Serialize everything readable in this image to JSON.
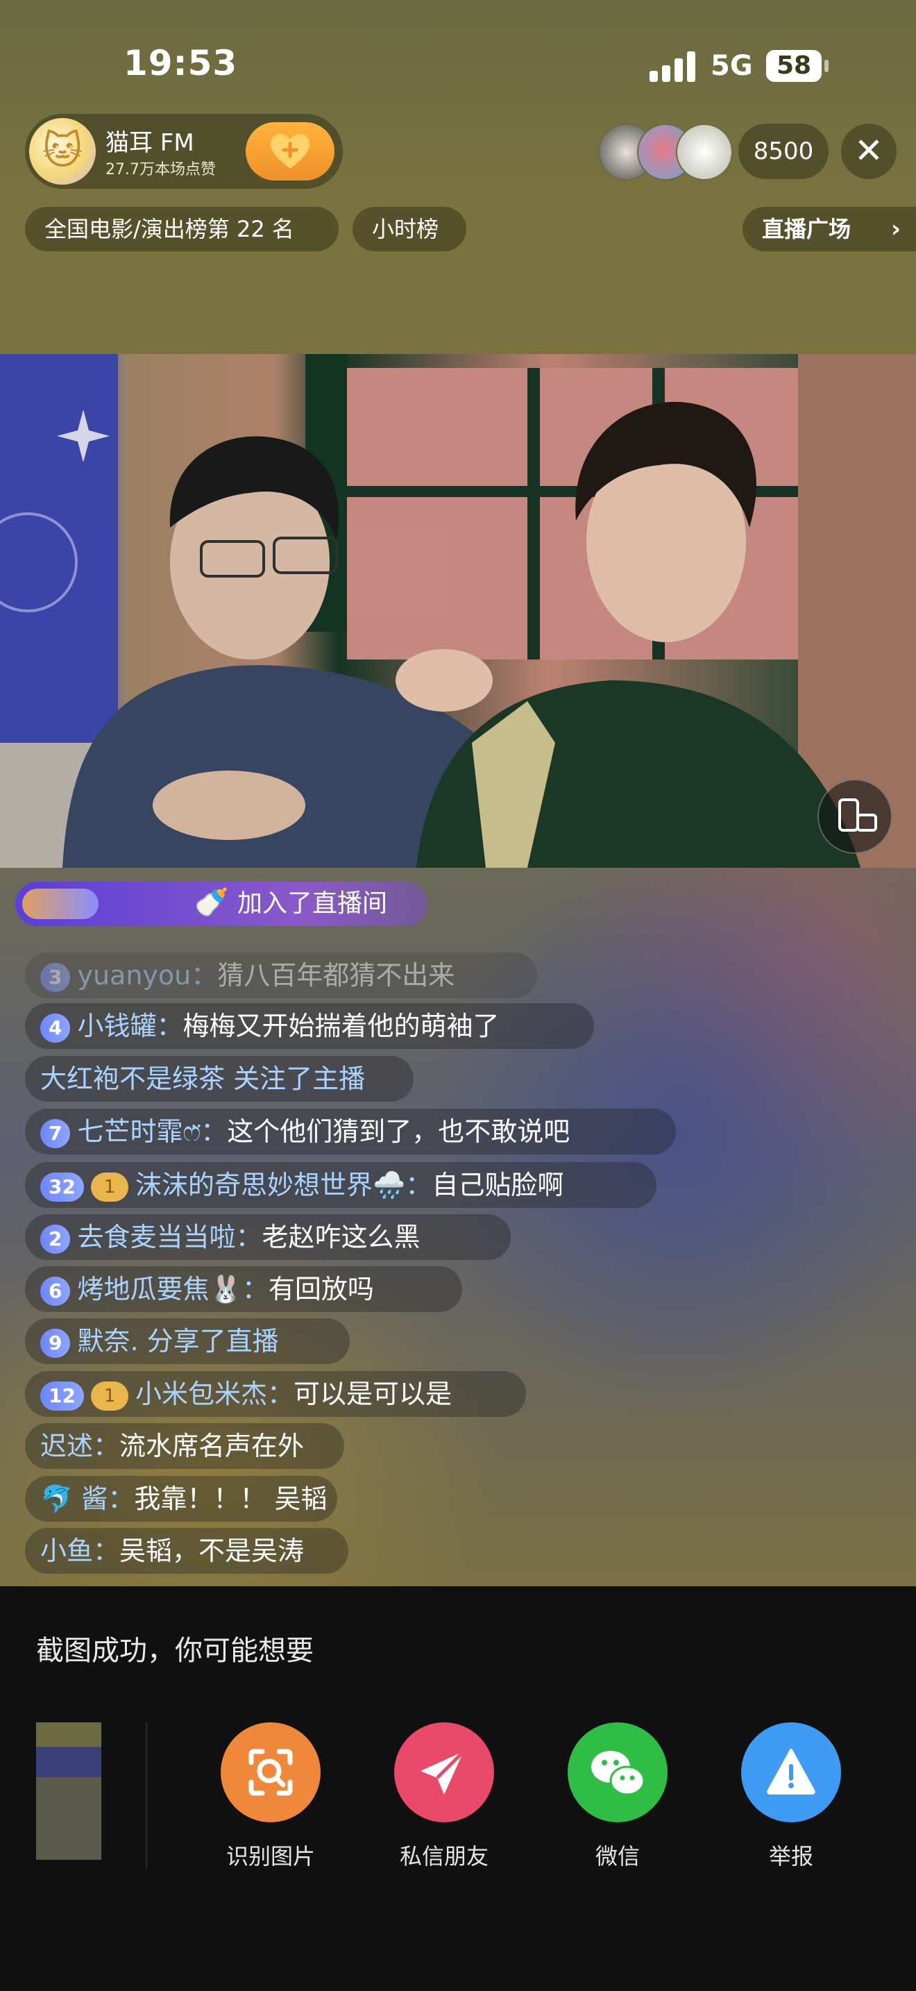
{
  "status_bar": {
    "time": "19:53",
    "network": "5G",
    "battery": "58"
  },
  "host": {
    "name": "猫耳 FM",
    "likes": "27.7万本场点赞",
    "avatar_icon": "cat-ear-icon"
  },
  "viewer_count": "8500",
  "rank_pill": "全国电影/演出榜第 22 名",
  "hour_pill": "小时榜",
  "plaza_label": "直播广场",
  "join_banner": {
    "text": "加入了直播间"
  },
  "chat": [
    {
      "level": "3",
      "badge": "",
      "name": "yuanyou",
      "sep": "：",
      "message": "猜八百年都猜不出来",
      "faded": true
    },
    {
      "level": "4",
      "badge": "",
      "name": "小钱罐",
      "sep": "：",
      "message": "梅梅又开始揣着他的萌袖了",
      "faded": false
    },
    {
      "level": "",
      "badge": "",
      "name": "大红袍不是绿茶 关注了主播",
      "sep": "",
      "message": "",
      "faded": false,
      "plain": true
    },
    {
      "level": "7",
      "badge": "",
      "name": "七芒时霏ෆ̈",
      "sep": "：",
      "message": "这个他们猜到了，也不敢说吧",
      "faded": false
    },
    {
      "level": "32",
      "badge": "1",
      "name": "沫沫的奇思妙想世界🌧️",
      "sep": "：",
      "message": "自己贴脸啊",
      "faded": false
    },
    {
      "level": "2",
      "badge": "",
      "name": "去食麦当当啦",
      "sep": "：",
      "message": "老赵咋这么黑",
      "faded": false
    },
    {
      "level": "6",
      "badge": "",
      "name": "烤地瓜要焦🐰",
      "sep": "：",
      "message": "有回放吗",
      "faded": false
    },
    {
      "level": "9",
      "badge": "",
      "name": "默奈. 分享了直播",
      "sep": "",
      "message": "",
      "faded": false,
      "plain": false
    },
    {
      "level": "12",
      "badge": "1",
      "name": "小米包米杰",
      "sep": "：",
      "message": "可以是可以是",
      "faded": false
    },
    {
      "level": "",
      "badge": "",
      "name": "迟述",
      "sep": "：",
      "message": "流水席名声在外",
      "faded": false
    },
    {
      "level": "",
      "badge": "",
      "name": "🐬 酱",
      "sep": "：",
      "message": "我靠！！！ 吴韬",
      "faded": false
    },
    {
      "level": "",
      "badge": "",
      "name": "小鱼",
      "sep": "：",
      "message": "吴韬，不是吴涛",
      "faded": false
    }
  ],
  "sheet": {
    "title": "截图成功，你可能想要",
    "actions": [
      {
        "label": "识别图片",
        "color": "#f0883a",
        "icon": "scan-image-icon"
      },
      {
        "label": "私信朋友",
        "color": "#e94a6a",
        "icon": "paper-plane-icon"
      },
      {
        "label": "微信",
        "color": "#2fbd45",
        "icon": "wechat-icon"
      },
      {
        "label": "举报",
        "color": "#3d9bf4",
        "icon": "warning-icon"
      }
    ]
  }
}
